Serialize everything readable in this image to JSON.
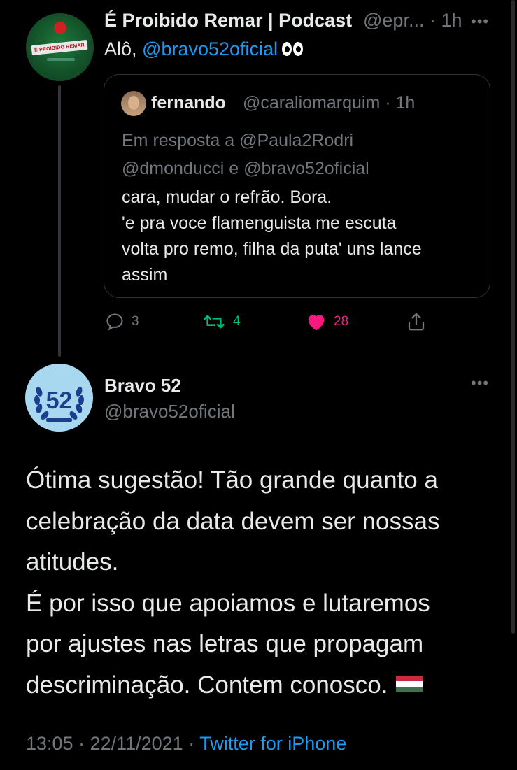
{
  "parent_tweet": {
    "author_name": "É Proibido Remar | Podcast",
    "author_handle": "@epr...",
    "time": "· 1h",
    "avatar_text": "É PROIBIDO REMAR",
    "text_prefix": "Alô, ",
    "mention": "@bravo52oficial",
    "more_icon": "more-dots-icon",
    "quoted": {
      "author_name": "fernando",
      "author_handle": "@caraliomarquim",
      "time": "· 1h",
      "reply_to_line1": "Em resposta a @Paula2Rodri",
      "reply_to_line2": "@dmonducci e @bravo52oficial",
      "lines": [
        "cara, mudar o refrão. Bora.",
        "'e pra voce flamenguista me escuta",
        "volta pro remo, filha da puta' uns lance",
        "assim"
      ]
    },
    "actions": {
      "replies": "3",
      "retweets": "4",
      "likes": "28"
    }
  },
  "main_tweet": {
    "author_name": "Bravo 52",
    "author_handle": "@bravo52oficial",
    "avatar_text": "52",
    "lines": [
      "Ótima sugestão! Tão grande quanto a",
      "celebração da data devem ser nossas",
      "atitudes.",
      "É por isso que apoiamos e lutaremos",
      "por ajustes nas letras que propagam",
      "descriminação. Contem conosco."
    ],
    "timestamp": "13:05 · 22/11/2021 · ",
    "source": "Twitter for iPhone"
  },
  "colors": {
    "background": "#000000",
    "text": "#e7e9ea",
    "muted": "#71767b",
    "link": "#1d9bf0",
    "retweet": "#00ba7c",
    "like": "#f91880"
  }
}
